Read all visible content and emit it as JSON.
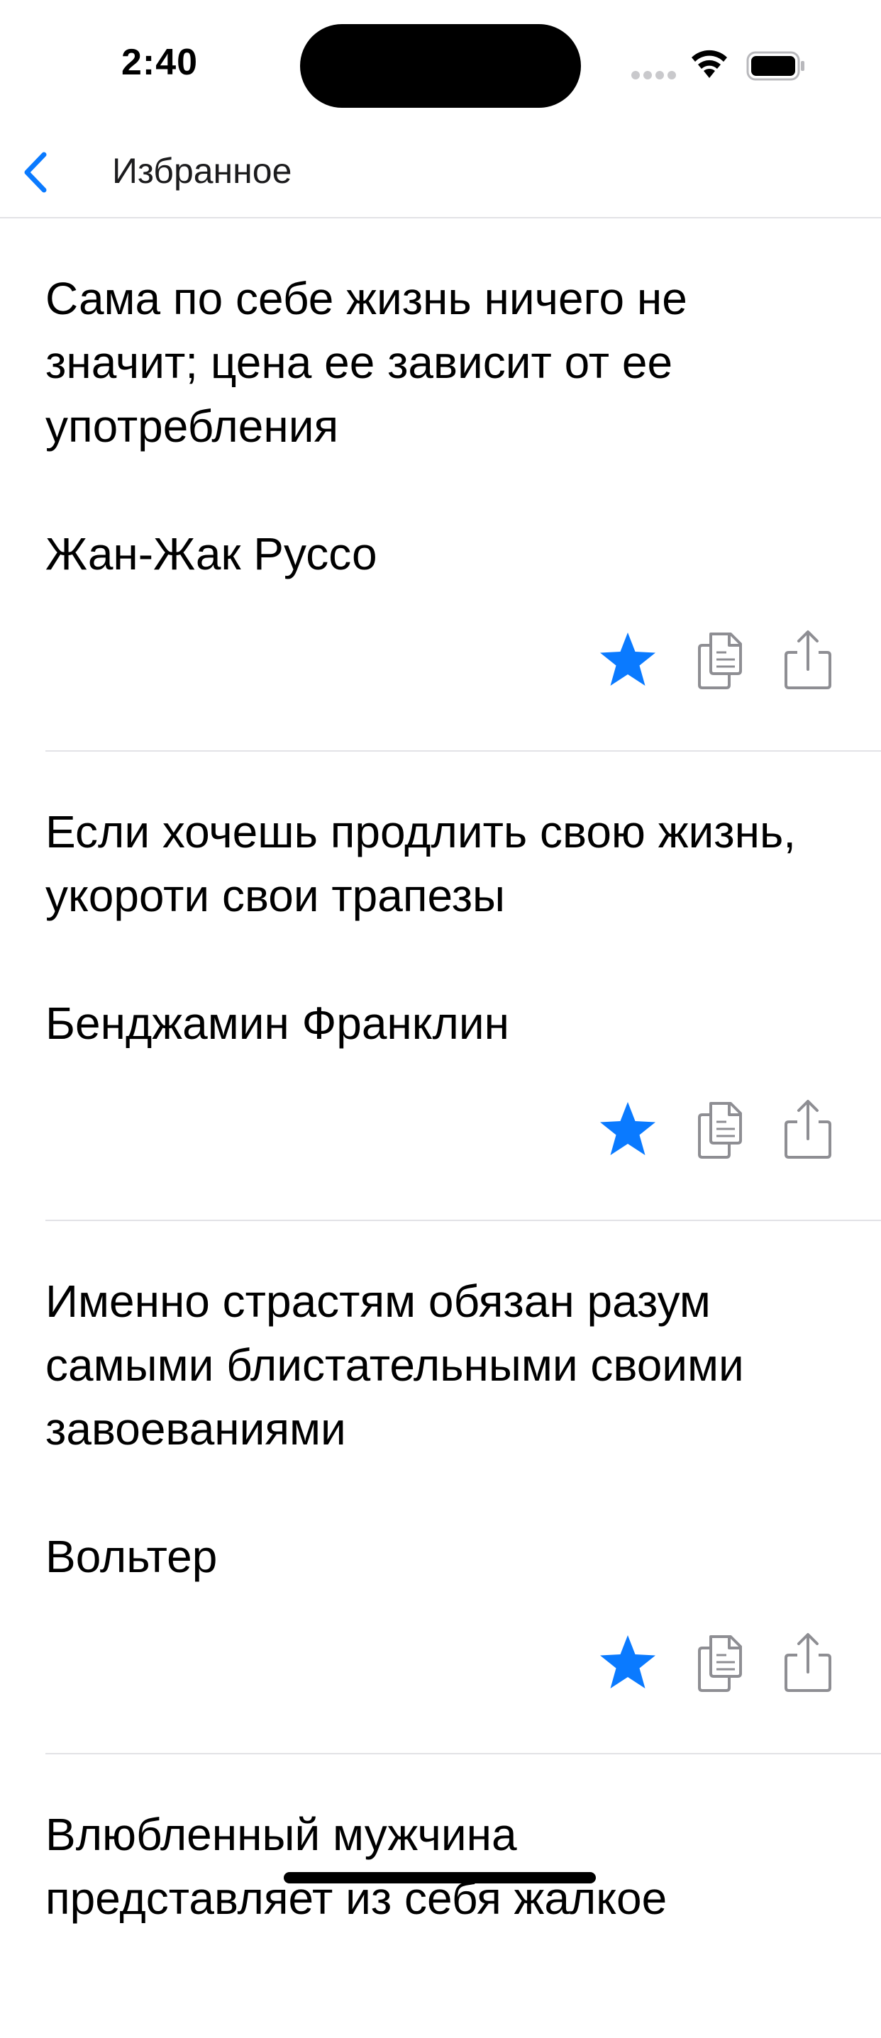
{
  "status_bar": {
    "time": "2:40"
  },
  "nav": {
    "title": "Избранное",
    "back_icon": "chevron-left-icon"
  },
  "colors": {
    "accent": "#0a7aff",
    "icon_gray": "#8e8e93",
    "separator": "#e2e2e6"
  },
  "quotes": [
    {
      "text": "Сама по себе жизнь ничего не значит; цена ее зависит от ее употребления",
      "author": "Жан-Жак Руссо",
      "favorite": true
    },
    {
      "text": "Если хочешь продлить свою жизнь, укороти свои трапезы",
      "author": "Бенджамин Франклин",
      "favorite": true
    },
    {
      "text": "Именно страстям обязан разум самыми блистательными своими завоеваниями",
      "author": "Вольтер",
      "favorite": true
    },
    {
      "text": "Влюбленный мужчина представляет из себя жалкое",
      "author": "",
      "favorite": true
    }
  ],
  "actions": {
    "favorite_icon": "star-icon",
    "copy_icon": "copy-icon",
    "share_icon": "share-icon"
  }
}
